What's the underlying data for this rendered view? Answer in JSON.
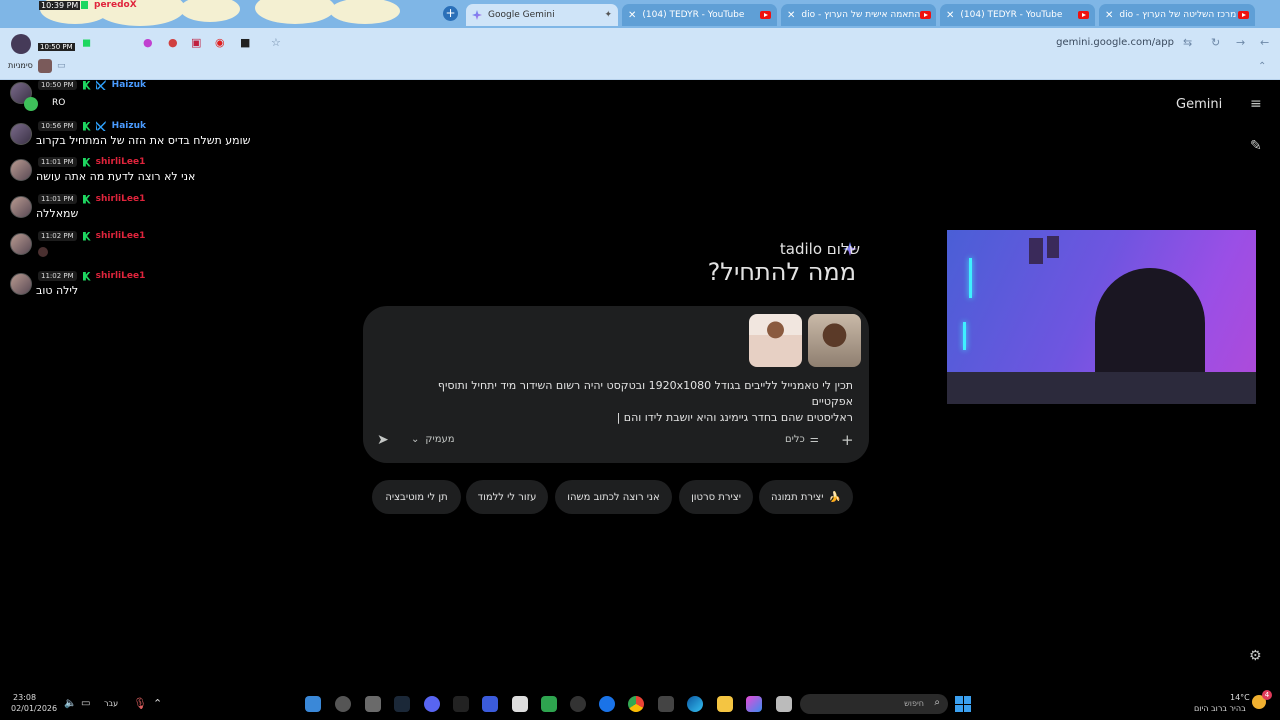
{
  "tabs": [
    {
      "title": "Google Gemini",
      "active": true
    },
    {
      "title": "(104) TEDYR - YouTube",
      "active": false
    },
    {
      "title": "התאמה אישית של הערוץ - dio",
      "active": false
    },
    {
      "title": "(104) TEDYR - YouTube",
      "active": false
    },
    {
      "title": "מרכז השליטה של הערוץ - dio",
      "active": false
    }
  ],
  "overlay_top": {
    "time": "10:39 PM",
    "user": "peredoX",
    "time2": "10:50 PM"
  },
  "toolbar": {
    "url": "gemini.google.com/app",
    "bookmarks_label": "סימניות"
  },
  "chat": [
    {
      "time": "10:50 PM",
      "user": "Haizuk",
      "user_color": "blue",
      "text": "RO"
    },
    {
      "time": "10:56 PM",
      "user": "Haizuk",
      "user_color": "blue",
      "text": "שומע תשלח בדיס את הזה של המתחיל בקרוב"
    },
    {
      "time": "11:01 PM",
      "user": "shirliLee1",
      "user_color": "red",
      "text": "אני לא רוצה לדעת מה אתה עושה"
    },
    {
      "time": "11:01 PM",
      "user": "shirliLee1",
      "user_color": "red",
      "text": "שמאללה"
    },
    {
      "time": "11:02 PM",
      "user": "shirliLee1",
      "user_color": "red",
      "text": ""
    },
    {
      "time": "11:02 PM",
      "user": "shirliLee1",
      "user_color": "red",
      "text": "לילה טוב"
    }
  ],
  "gemini": {
    "brand": "Gemini",
    "greeting": "שלום tadilo",
    "headline": "ממה להתחיל?",
    "prompt_line1": "תכין לי טאמנייל ללייבים בגודל 1920x1080 ובטקסט יהיה רשום השידור מיד יתחיל ותוסיף אפקטיים",
    "prompt_line2": "ראליסטים שהם בחדר גיימינג והיא יושבת לידו והם |",
    "mode_label": "מעמיק",
    "tools_label": "כלים",
    "chips": [
      "יצירת תמונה",
      "יצירת סרטון",
      "אני רוצה לכתוב משהו",
      "עזור לי ללמוד",
      "תן לי מוטיבציה"
    ],
    "chip_emoji": "🍌"
  },
  "taskbar": {
    "time": "23:08",
    "date": "02/01/2026",
    "lang": "עבר",
    "weather_temp": "14°C",
    "weather_desc": "בהיר ברוב היום",
    "search_text": "חיפוש",
    "notif_count": "4"
  }
}
